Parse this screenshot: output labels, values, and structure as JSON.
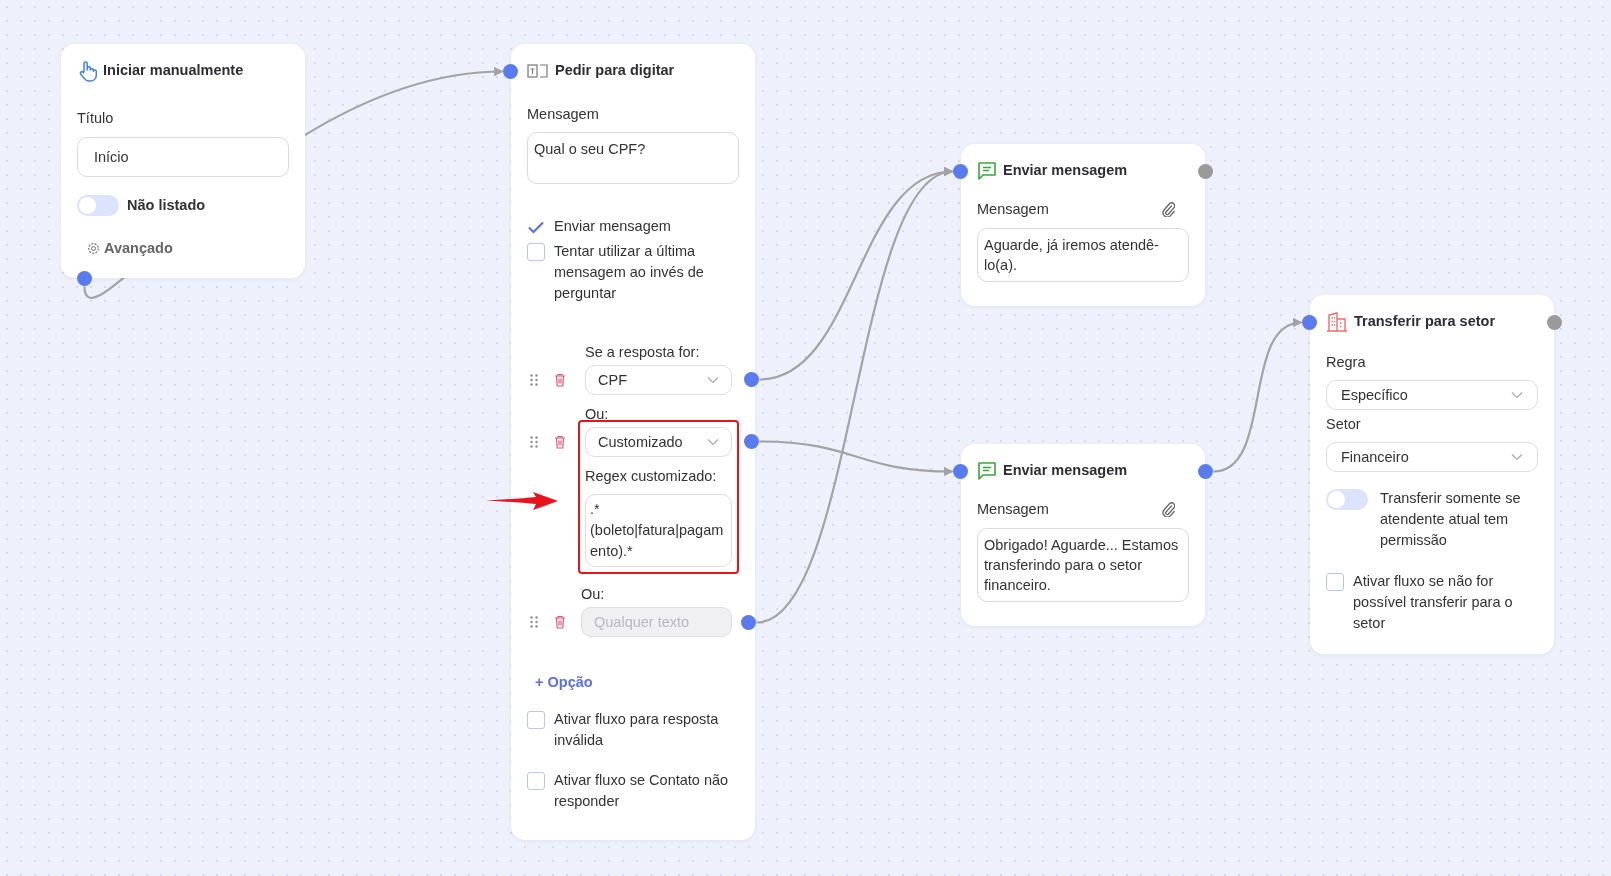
{
  "nodes": [
    {
      "kind": "start",
      "title": "Iniciar manualmente",
      "field_label": "Título",
      "field_value": "Início",
      "toggle": {
        "label": "Não listado",
        "on": false
      },
      "advanced": "Avançado"
    },
    {
      "kind": "ask",
      "title": "Pedir para digitar",
      "message_label": "Mensagem",
      "message": "Qual o seu CPF?",
      "checks": [
        {
          "label": "Enviar mensagem",
          "checked": true
        },
        {
          "label": "Tentar utilizar a última mensagem ao invés de perguntar",
          "checked": false
        }
      ],
      "answers": [
        {
          "kind": "select",
          "heading": "Se a resposta for:",
          "value": "CPF",
          "highlighted": false
        },
        {
          "kind": "select",
          "heading": "Ou:",
          "value": "Customizado",
          "regex_label": "Regex customizado:",
          "regex": ".* (boleto|fatura|pagamento).*",
          "highlighted": true
        },
        {
          "kind": "text",
          "heading": "Ou:",
          "placeholder": "Qualquer texto",
          "highlighted": false
        }
      ],
      "add_option": "+ Opção",
      "footer_checks": [
        {
          "label": "Ativar fluxo para resposta inválida",
          "checked": false
        },
        {
          "label": "Ativar fluxo se Contato não responder",
          "checked": false
        }
      ]
    },
    {
      "kind": "message",
      "title": "Enviar mensagem",
      "message_label": "Mensagem",
      "message": "Aguarde, já iremos atendê-lo(a).",
      "output_connected": false
    },
    {
      "kind": "message",
      "title": "Enviar mensagem",
      "message_label": "Mensagem",
      "message": "Obrigado! Aguarde... Estamos transferindo para o setor financeiro.",
      "output_connected": true
    },
    {
      "kind": "transfer",
      "title": "Transferir para setor",
      "rule_label": "Regra",
      "rule": "Específico",
      "sector_label": "Setor",
      "sector": "Financeiro",
      "toggle": {
        "label": "Transferir somente se atendente atual tem permissão",
        "on": false
      },
      "checks": [
        {
          "label": "Ativar fluxo se não for possível transferir para o setor",
          "checked": false
        }
      ],
      "output_connected": false
    }
  ]
}
